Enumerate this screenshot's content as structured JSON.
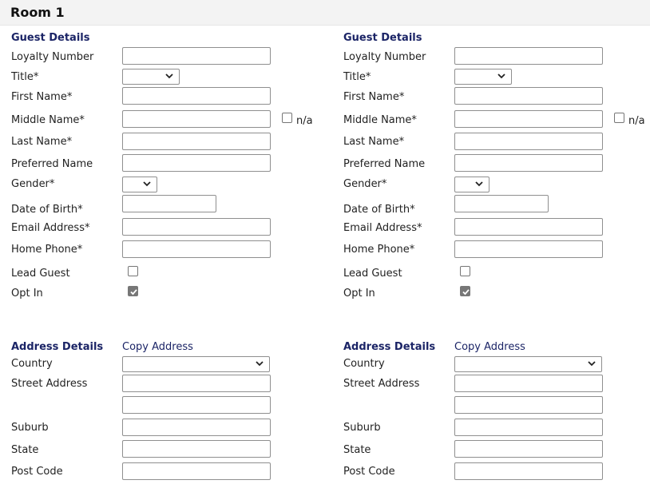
{
  "room": {
    "title": "Room 1"
  },
  "guests": [
    {
      "guest_details_title": "Guest Details",
      "labels": {
        "loyalty": "Loyalty Number",
        "title": "Title*",
        "first_name": "First Name*",
        "middle_name": "Middle Name*",
        "last_name": "Last Name*",
        "preferred_name": "Preferred Name",
        "gender": "Gender*",
        "dob": "Date of Birth*",
        "email": "Email Address*",
        "home_phone": "Home Phone*",
        "lead_guest": "Lead Guest",
        "opt_in": "Opt In"
      },
      "na_label": "n/a",
      "values": {
        "loyalty": "",
        "title": "",
        "first_name": "",
        "middle_name": "",
        "last_name": "",
        "preferred_name": "",
        "gender": "",
        "dob": "",
        "email": "",
        "home_phone": ""
      },
      "checkboxes": {
        "middle_name_na": false,
        "lead_guest": false,
        "opt_in": true
      },
      "address_details_title": "Address Details",
      "copy_address": "Copy Address",
      "address_labels": {
        "country": "Country",
        "street": "Street Address",
        "suburb": "Suburb",
        "state": "State",
        "post_code": "Post Code"
      },
      "address_values": {
        "country": "",
        "street1": "",
        "street2": "",
        "suburb": "",
        "state": "",
        "post_code": ""
      }
    },
    {
      "guest_details_title": "Guest Details",
      "labels": {
        "loyalty": "Loyalty Number",
        "title": "Title*",
        "first_name": "First Name*",
        "middle_name": "Middle Name*",
        "last_name": "Last Name*",
        "preferred_name": "Preferred Name",
        "gender": "Gender*",
        "dob": "Date of Birth*",
        "email": "Email Address*",
        "home_phone": "Home Phone*",
        "lead_guest": "Lead Guest",
        "opt_in": "Opt In"
      },
      "na_label": "n/a",
      "values": {
        "loyalty": "",
        "title": "",
        "first_name": "",
        "middle_name": "",
        "last_name": "",
        "preferred_name": "",
        "gender": "",
        "dob": "",
        "email": "",
        "home_phone": ""
      },
      "checkboxes": {
        "middle_name_na": false,
        "lead_guest": false,
        "opt_in": true
      },
      "address_details_title": "Address Details",
      "copy_address": "Copy Address",
      "address_labels": {
        "country": "Country",
        "street": "Street Address",
        "suburb": "Suburb",
        "state": "State",
        "post_code": "Post Code"
      },
      "address_values": {
        "country": "",
        "street1": "",
        "street2": "",
        "suburb": "",
        "state": "",
        "post_code": ""
      }
    }
  ]
}
